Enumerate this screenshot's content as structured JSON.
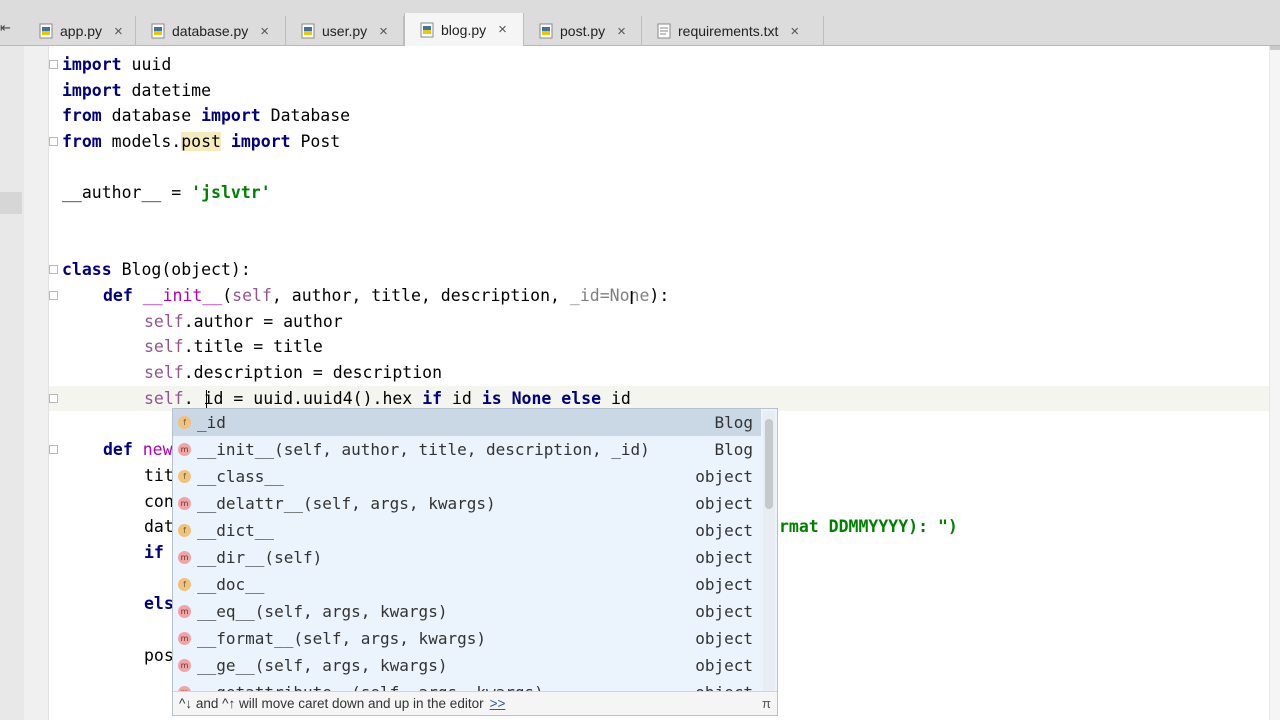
{
  "tabs": [
    {
      "label": "app.py",
      "icon": "python-file-icon"
    },
    {
      "label": "database.py",
      "icon": "python-file-icon"
    },
    {
      "label": "user.py",
      "icon": "python-file-icon"
    },
    {
      "label": "blog.py",
      "icon": "python-file-icon",
      "active": true
    },
    {
      "label": "post.py",
      "icon": "python-file-icon"
    },
    {
      "label": "requirements.txt",
      "icon": "text-file-icon"
    }
  ],
  "tab_scroll_glyph": "⇤",
  "close_glyph": "×",
  "code": {
    "l1_kw": "import",
    "l1_rest": " uuid",
    "l2_kw": "import",
    "l2_rest": " datetime",
    "l3_kw1": "from",
    "l3_mod": " database ",
    "l3_kw2": "import",
    "l3_rest": " Database",
    "l4_kw1": "from",
    "l4_mod1": " models.",
    "l4_mod2": "post",
    "l4_sp": " ",
    "l4_kw2": "import",
    "l4_rest": " Post",
    "l6_name": "__author__",
    "l6_eq": " = ",
    "l6_str": "'jslvtr'",
    "l9_kw": "class",
    "l9_name": " Blog",
    "l9_rest": "(object):",
    "l10_kw": "def",
    "l10_name": " __init__",
    "l10_p1": "(",
    "l10_self": "self",
    "l10_args": ", author, title, description, ",
    "l10_id": "_id=None",
    "l10_end": "):",
    "l11_self": "self",
    "l11_rest": ".author = author",
    "l12_self": "self",
    "l12_rest": ".title = title",
    "l13_self": "self",
    "l13_rest": ".description = description",
    "l14_self": "self",
    "l14_dot": ". ",
    "l14_id": "id",
    "l14_rest": " = uuid.uuid4().hex ",
    "l14_kw1": "if",
    "l14_mid": " id ",
    "l14_kw2": "is",
    "l14_kw3": " None",
    "l14_sp": " ",
    "l14_kw4": "else",
    "l14_end": " id",
    "l16_kw": "def",
    "l16_name": " new",
    "l17": "tit",
    "l18": "con",
    "l19": "dat",
    "l19_tail": "rmat DDMMYYYY): \")",
    "l20_kw": "if",
    "l22_kw": "els",
    "l24": "pos"
  },
  "completion": {
    "items": [
      {
        "kind": "f",
        "name": "_id",
        "type": "Blog"
      },
      {
        "kind": "m",
        "name": "__init__(self, author, title, description, _id)",
        "type": "Blog"
      },
      {
        "kind": "f",
        "name": "__class__",
        "type": "object"
      },
      {
        "kind": "m",
        "name": "__delattr__(self, args, kwargs)",
        "type": "object"
      },
      {
        "kind": "f",
        "name": "__dict__",
        "type": "object"
      },
      {
        "kind": "m",
        "name": "__dir__(self)",
        "type": "object"
      },
      {
        "kind": "f",
        "name": "__doc__",
        "type": "object"
      },
      {
        "kind": "m",
        "name": "__eq__(self, args, kwargs)",
        "type": "object"
      },
      {
        "kind": "m",
        "name": "__format__(self, args, kwargs)",
        "type": "object"
      },
      {
        "kind": "m",
        "name": "__ge__(self, args, kwargs)",
        "type": "object"
      },
      {
        "kind": "m",
        "name": "__getattribute__(self, args, kwargs)",
        "type": "object"
      }
    ],
    "footer_text": "^↓ and ^↑ will move caret down and up in the editor",
    "footer_link": ">>",
    "footer_pi": "π"
  }
}
